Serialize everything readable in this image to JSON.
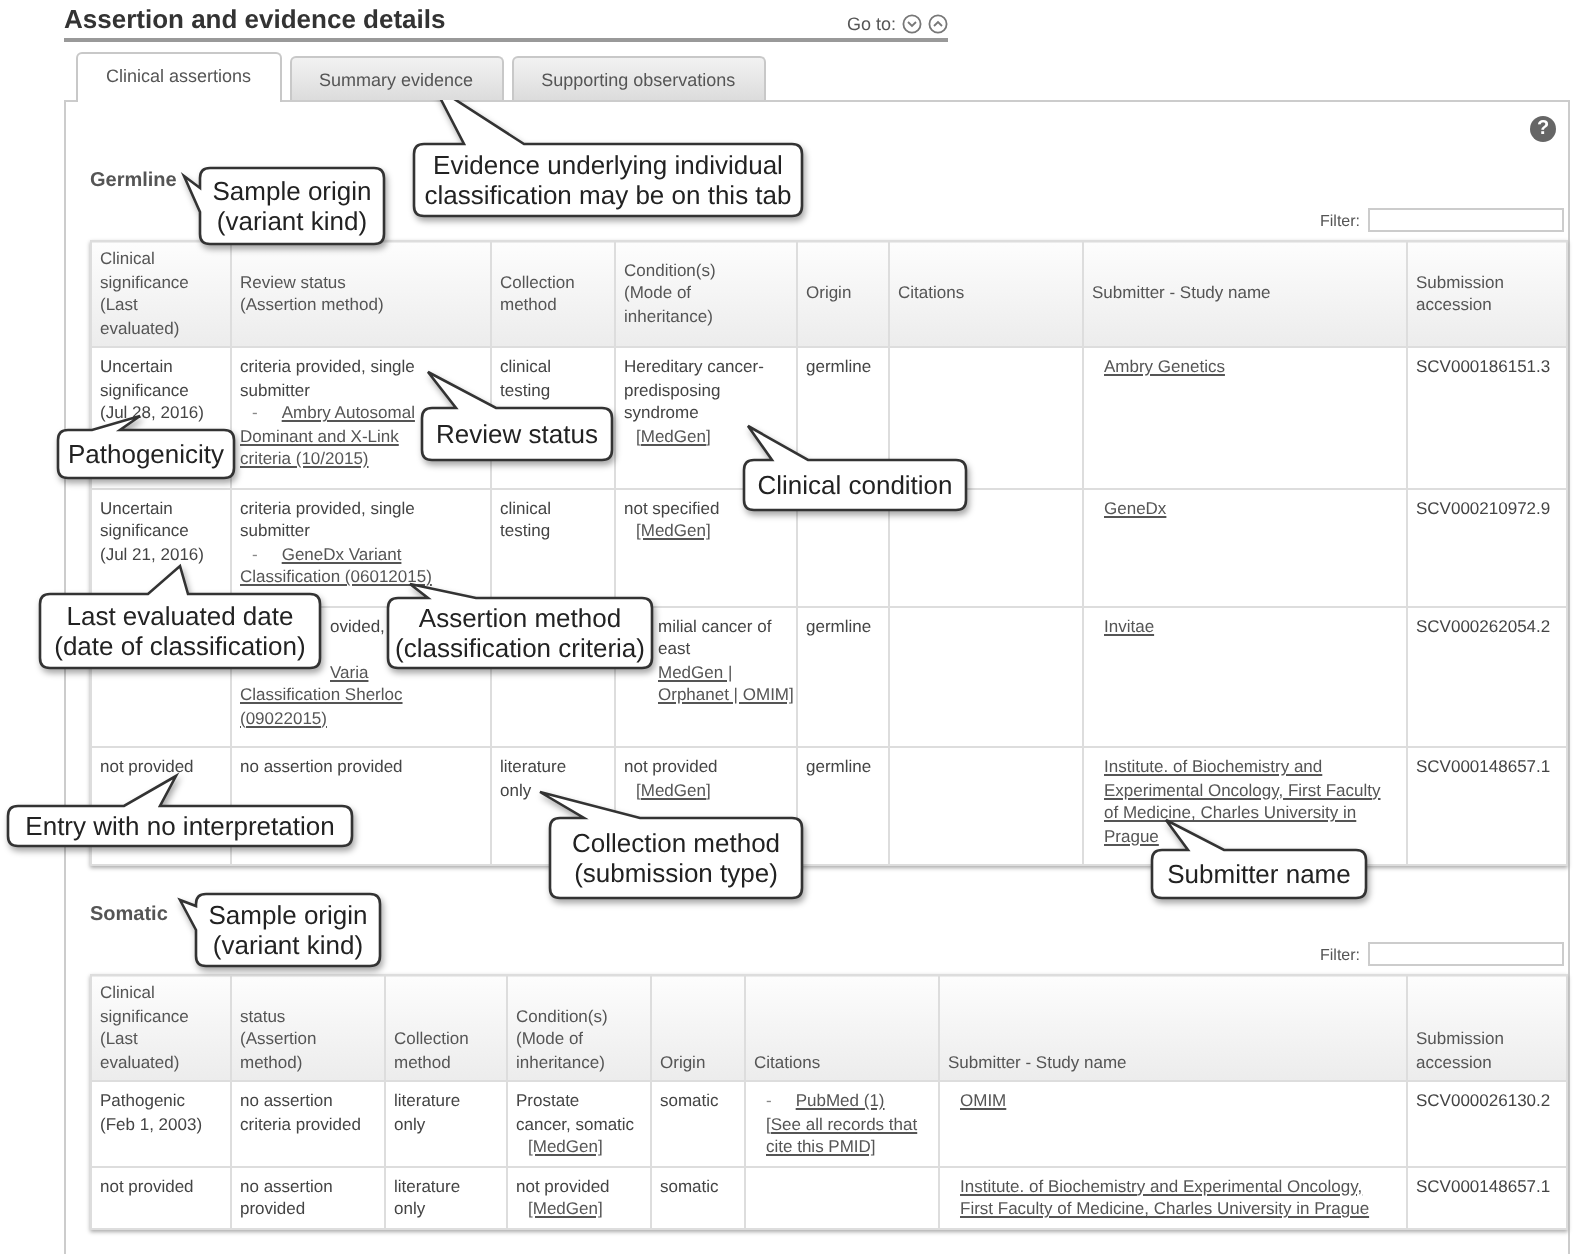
{
  "section_title": "Assertion and evidence details",
  "goto": {
    "label": "Go to:"
  },
  "tabs": [
    {
      "label": "Clinical assertions",
      "selected": true
    },
    {
      "label": "Summary evidence",
      "selected": false
    },
    {
      "label": "Supporting observations",
      "selected": false
    }
  ],
  "help": "?",
  "groups": [
    {
      "heading": "Germline",
      "filter_label": "Filter:",
      "columns": [
        "Clinical\nsignificance\n(Last\nevaluated)",
        "Review status\n(Assertion method)",
        "Collection\nmethod",
        "Condition(s)\n(Mode of\ninheritance)",
        "Origin",
        "Citations",
        "Submitter - Study name",
        "Submission\naccession"
      ],
      "rows": [
        {
          "cells": [
            [
              {
                "kind": "text",
                "text": "Uncertain significance (Jul 28, 2016)"
              }
            ],
            [
              {
                "kind": "text",
                "text": "criteria provided, single submitter"
              },
              {
                "kind": "bullet-link",
                "bullet": "-",
                "text": "Ambry Autosomal"
              },
              {
                "kind": "cont-link",
                "text": "Dominant and X-Link"
              },
              {
                "kind": "cont-link",
                "text": "criteria (10/2015)"
              }
            ],
            [
              {
                "kind": "text",
                "text": "clinical testing"
              }
            ],
            [
              {
                "kind": "text",
                "text": "Hereditary cancer-predisposing syndrome"
              },
              {
                "kind": "link",
                "text": "[MedGen]"
              }
            ],
            [
              {
                "kind": "text",
                "text": "germline"
              }
            ],
            [],
            [
              {
                "kind": "link",
                "text": "Ambry Genetics"
              }
            ],
            [
              {
                "kind": "text",
                "text": "SCV000186151.3"
              }
            ]
          ]
        },
        {
          "cells": [
            [
              {
                "kind": "text",
                "text": "Uncertain significance (Jul 21, 2016)"
              }
            ],
            [
              {
                "kind": "text",
                "text": "criteria provided, single submitter"
              },
              {
                "kind": "bullet-link",
                "bullet": "-",
                "text": "GeneDx Variant"
              },
              {
                "kind": "cont-link",
                "text": "Classification (06012015)"
              }
            ],
            [
              {
                "kind": "text",
                "text": "clinical testing"
              }
            ],
            [
              {
                "kind": "text",
                "text": "not specified"
              },
              {
                "kind": "link",
                "text": "[MedGen]"
              }
            ],
            [],
            [],
            [
              {
                "kind": "link",
                "text": "GeneDx"
              }
            ],
            [
              {
                "kind": "text",
                "text": "SCV000210972.9"
              }
            ]
          ]
        },
        {
          "cells": [
            [],
            [
              {
                "kind": "cut-text",
                "text": "ovided,"
              },
              {
                "kind": "cut-link",
                "text": "Varia"
              },
              {
                "kind": "cont-link",
                "text": "Classification Sherloc"
              },
              {
                "kind": "cont-link",
                "text": "(09022015)"
              }
            ],
            [],
            [
              {
                "kind": "cut-text",
                "text": "milial cancer of"
              },
              {
                "kind": "cut-text",
                "text": "east"
              },
              {
                "kind": "cut-link",
                "text": "MedGen |"
              },
              {
                "kind": "cut-link",
                "text": "Orphanet | OMIM]"
              }
            ],
            [
              {
                "kind": "text",
                "text": "germline"
              }
            ],
            [],
            [
              {
                "kind": "link",
                "text": "Invitae"
              }
            ],
            [
              {
                "kind": "text",
                "text": "SCV000262054.2"
              }
            ]
          ]
        },
        {
          "cells": [
            [
              {
                "kind": "text",
                "text": "not provided"
              }
            ],
            [
              {
                "kind": "text",
                "text": "no assertion provided"
              }
            ],
            [
              {
                "kind": "text",
                "text": "literature only"
              }
            ],
            [
              {
                "kind": "text",
                "text": "not provided"
              },
              {
                "kind": "link",
                "text": "[MedGen]"
              }
            ],
            [
              {
                "kind": "text",
                "text": "germline"
              }
            ],
            [],
            [
              {
                "kind": "link",
                "text": "Institute. of Biochemistry and Experimental Oncology, First Faculty of Medicine, Charles University in Prague"
              }
            ],
            [
              {
                "kind": "text",
                "text": "SCV000148657.1"
              }
            ]
          ]
        }
      ]
    },
    {
      "heading": "Somatic",
      "filter_label": "Filter:",
      "columns": [
        "Clinical\nsignificance\n(Last\nevaluated)",
        "status\n(Assertion\nmethod)",
        "Collection\nmethod",
        "Condition(s)\n(Mode of\ninheritance)",
        "Origin",
        "Citations",
        "Submitter - Study name",
        "Submission\naccession"
      ],
      "rows": [
        {
          "cells": [
            [
              {
                "kind": "text",
                "text": "Pathogenic (Feb 1, 2003)"
              }
            ],
            [
              {
                "kind": "text",
                "text": "no assertion criteria provided"
              }
            ],
            [
              {
                "kind": "text",
                "text": "literature only"
              }
            ],
            [
              {
                "kind": "text",
                "text": "Prostate cancer, somatic"
              },
              {
                "kind": "link",
                "text": "[MedGen]"
              }
            ],
            [
              {
                "kind": "text",
                "text": "somatic"
              }
            ],
            [
              {
                "kind": "bullet-link",
                "bullet": "-",
                "text": "PubMed (1)"
              },
              {
                "kind": "link",
                "text": "[See all records that cite this PMID]"
              }
            ],
            [
              {
                "kind": "link",
                "text": "OMIM"
              }
            ],
            [
              {
                "kind": "text",
                "text": "SCV000026130.2"
              }
            ]
          ]
        },
        {
          "cells": [
            [
              {
                "kind": "text",
                "text": "not provided"
              }
            ],
            [
              {
                "kind": "text",
                "text": "no assertion provided"
              }
            ],
            [
              {
                "kind": "text",
                "text": "literature only"
              }
            ],
            [
              {
                "kind": "text",
                "text": "not provided"
              },
              {
                "kind": "link",
                "text": "[MedGen]"
              }
            ],
            [
              {
                "kind": "text",
                "text": "somatic"
              }
            ],
            [],
            [
              {
                "kind": "link",
                "text": "Institute. of Biochemistry and Experimental Oncology, First Faculty of Medicine, Charles University in Prague"
              }
            ],
            [
              {
                "kind": "text",
                "text": "SCV000148657.1"
              }
            ]
          ]
        }
      ]
    }
  ],
  "callouts": [
    {
      "text": "Evidence underlying individual\nclassification may be on this tab"
    },
    {
      "text": "Sample origin\n(variant kind)"
    },
    {
      "text": "Pathogenicity"
    },
    {
      "text": "Review status"
    },
    {
      "text": "Clinical condition"
    },
    {
      "text": "Last evaluated date\n(date of classification)"
    },
    {
      "text": "Assertion method\n(classification criteria)"
    },
    {
      "text": "Entry with no interpretation"
    },
    {
      "text": "Collection method\n(submission type)"
    },
    {
      "text": "Submitter name"
    },
    {
      "text": "Sample origin\n(variant kind)"
    }
  ]
}
